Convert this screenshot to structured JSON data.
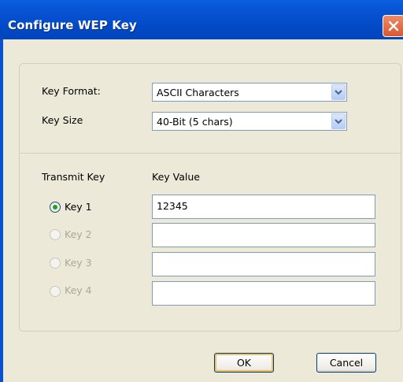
{
  "window": {
    "title": "Configure WEP Key"
  },
  "key_format": {
    "label": "Key Format:",
    "selected": "ASCII Characters"
  },
  "key_size": {
    "label": "Key Size",
    "selected": "40-Bit (5 chars)"
  },
  "transmit": {
    "header_transmit": "Transmit Key",
    "header_value": "Key Value",
    "keys": [
      {
        "label": "Key 1",
        "selected": true,
        "enabled": true,
        "value": "12345"
      },
      {
        "label": "Key 2",
        "selected": false,
        "enabled": false,
        "value": ""
      },
      {
        "label": "Key 3",
        "selected": false,
        "enabled": false,
        "value": ""
      },
      {
        "label": "Key 4",
        "selected": false,
        "enabled": false,
        "value": ""
      }
    ]
  },
  "buttons": {
    "ok": "OK",
    "cancel": "Cancel"
  },
  "icons": {
    "close": "close-icon",
    "dropdown": "chevron-down-icon"
  }
}
